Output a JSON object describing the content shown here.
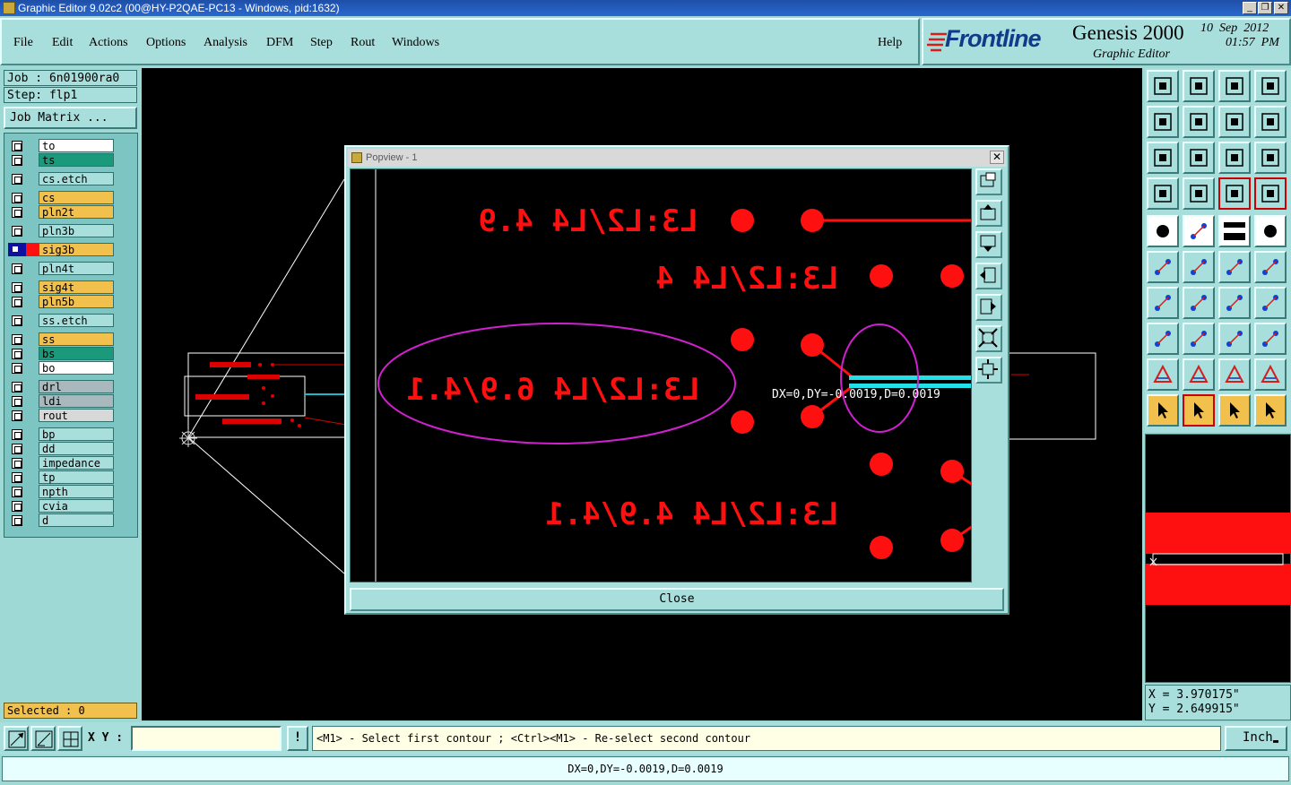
{
  "window": {
    "title": "Graphic Editor 9.02c2 (00@HY-P2QAE-PC13 - Windows, pid:1632)",
    "controls": [
      "_",
      "❐",
      "✕"
    ]
  },
  "menu": {
    "items": [
      "File",
      "Edit",
      "Actions",
      "Options",
      "Analysis",
      "DFM",
      "Step",
      "Rout",
      "Windows"
    ],
    "help": "Help"
  },
  "brand": {
    "logo_text": "Frontline",
    "product": "Genesis 2000",
    "subtitle": "Graphic Editor",
    "date": "10  Sep  2012",
    "time": "01:57  PM"
  },
  "job": {
    "job_label": "Job : 6n01900ra0",
    "step_label": "Step: flp1",
    "matrix_button": "Job Matrix ..."
  },
  "layers": [
    {
      "name": "to",
      "color": "#ffffff"
    },
    {
      "name": "ts",
      "color": "#1a9a7a"
    },
    {
      "name": "cs.etch",
      "color": "#a8dedb"
    },
    {
      "name": "cs",
      "color": "#f2c04d"
    },
    {
      "name": "pln2t",
      "color": "#f2c04d"
    },
    {
      "name": "pln3b",
      "color": "#a8dedb"
    },
    {
      "name": "sig3b",
      "color": "#f2c04d"
    },
    {
      "name": "pln4t",
      "color": "#a8dedb"
    },
    {
      "name": "sig4t",
      "color": "#f2c04d"
    },
    {
      "name": "pln5b",
      "color": "#f2c04d"
    },
    {
      "name": "ss.etch",
      "color": "#a8dedb"
    },
    {
      "name": "ss",
      "color": "#f2c04d"
    },
    {
      "name": "bs",
      "color": "#1a9a7a"
    },
    {
      "name": "bo",
      "color": "#ffffff"
    },
    {
      "name": "drl",
      "color": "#a8b8bc"
    },
    {
      "name": "ldi",
      "color": "#a8b8bc"
    },
    {
      "name": "rout",
      "color": "#d8d8d8"
    },
    {
      "name": "bp",
      "color": "#a8dedb"
    },
    {
      "name": "dd",
      "color": "#a8dedb"
    },
    {
      "name": "impedance",
      "color": "#a8dedb"
    },
    {
      "name": "tp",
      "color": "#a8dedb"
    },
    {
      "name": "npth",
      "color": "#a8dedb"
    },
    {
      "name": "cvia",
      "color": "#a8dedb"
    },
    {
      "name": "d",
      "color": "#a8dedb"
    }
  ],
  "selected": "Selected : 0",
  "popview": {
    "title": "Popview - 1",
    "close_button": "Close",
    "labels": [
      "L3:L2/L4 4.9",
      "L3:L2/L4 4",
      "L3:L2/L4 6.9/4.1",
      "L3:L2/L4 4.9/4.1"
    ],
    "measure_text": "DX=0,DY=-0.0019,D=0.0019"
  },
  "coords": {
    "x": "X = 3.970175\"",
    "y": "Y = 2.649915\""
  },
  "bottom": {
    "xy_label": "X Y :",
    "xy_value": "",
    "exclaim": "!",
    "prompt": "<M1> - Select first contour ; <Ctrl><M1> - Re-select second contour",
    "unit": "Inch",
    "status": "DX=0,DY=-0.0019,D=0.0019"
  },
  "colors": {
    "panel": "#a8dedb",
    "accent_red": "#ff0000",
    "highlight": "#f2c04d",
    "magenta": "#cc22cc",
    "cyan": "#22dddd"
  }
}
